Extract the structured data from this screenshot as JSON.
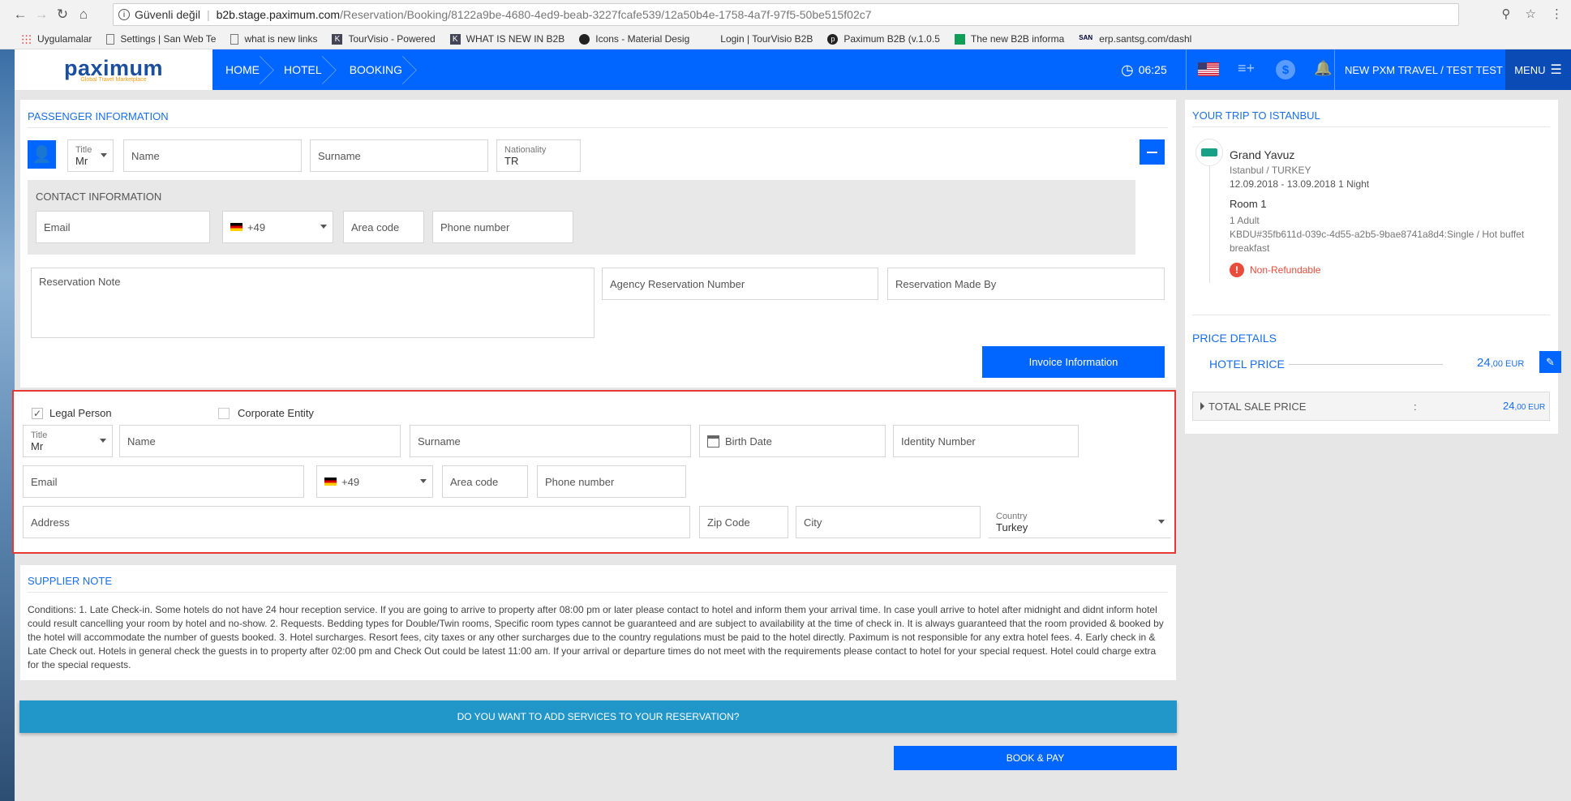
{
  "browser": {
    "security": "Güvenli değil",
    "url_host": "b2b.stage.paximum.com",
    "url_path": "/Reservation/Booking/8122a9be-4680-4ed9-beab-3227fcafe539/12a50b4e-1758-4a7f-97f5-50be515f02c7",
    "bookmarks": [
      {
        "label": "Uygulamalar",
        "icon": "apps-grid-icon"
      },
      {
        "label": "Settings | San Web Te",
        "icon": "page-icon"
      },
      {
        "label": "what is new links",
        "icon": "page-icon"
      },
      {
        "label": "TourVisio - Powered",
        "icon": "k-icon"
      },
      {
        "label": "WHAT IS NEW IN B2B",
        "icon": "k-icon"
      },
      {
        "label": "Icons - Material Desig",
        "icon": "github-icon"
      },
      {
        "label": "Login | TourVisio B2B",
        "icon": "blank-icon"
      },
      {
        "label": "Paximum B2B (v.1.0.5",
        "icon": "p-icon"
      },
      {
        "label": "The new B2B informa",
        "icon": "sheets-icon"
      },
      {
        "label": "erp.santsg.com/dashl",
        "icon": "san-icon"
      }
    ]
  },
  "header": {
    "logo": "paximum",
    "logo_sub": "Global Travel Marketplace",
    "breadcrumbs": [
      "HOME",
      "HOTEL",
      "BOOKING"
    ],
    "timer": "06:25",
    "agency": "NEW PXM TRAVEL / TEST TEST",
    "menu": "MENU"
  },
  "passenger": {
    "title": "PASSENGER INFORMATION",
    "title_label": "Title",
    "title_value": "Mr",
    "name_placeholder": "Name",
    "surname_placeholder": "Surname",
    "nationality_label": "Nationality",
    "nationality_value": "TR",
    "contact_title": "CONTACT INFORMATION",
    "email_placeholder": "Email",
    "phone_code": "+49",
    "area_placeholder": "Area code",
    "phone_placeholder": "Phone number",
    "note_placeholder": "Reservation Note",
    "agency_res_placeholder": "Agency Reservation Number",
    "made_by_placeholder": "Reservation Made By",
    "invoice_button": "Invoice Information"
  },
  "invoice": {
    "legal_person": "Legal Person",
    "corporate_entity": "Corporate Entity",
    "title_label": "Title",
    "title_value": "Mr",
    "name_placeholder": "Name",
    "surname_placeholder": "Surname",
    "birth_placeholder": "Birth Date",
    "identity_placeholder": "Identity Number",
    "email_placeholder": "Email",
    "phone_code": "+49",
    "area_placeholder": "Area code",
    "phone_placeholder": "Phone number",
    "address_placeholder": "Address",
    "zip_placeholder": "Zip Code",
    "city_placeholder": "City",
    "country_label": "Country",
    "country_value": "Turkey"
  },
  "supplier": {
    "title": "SUPPLIER NOTE",
    "text": "Conditions: 1. Late Check-in. Some hotels do not have 24 hour reception service. If you are going to arrive to property after 08:00 pm or later please contact to hotel and inform them your arrival time. In case youll arrive to hotel after midnight and didnt inform hotel could result cancelling your room by hotel and no-show. 2. Requests. Bedding types for Double/Twin rooms, Specific room types cannot be guaranteed and are subject to availability at the time of check in. It is always guaranteed that the room provided & booked by the hotel will accommodate the number of guests booked. 3. Hotel surcharges. Resort fees, city taxes or any other surcharges due to the country regulations must be paid to the hotel directly. Paximum is not responsible for any extra hotel fees. 4. Early check in & Late Check out. Hotels in general check the guests in to property after 02:00 pm and Check Out could be latest 11:00 am. If your arrival or departure times do not meet with the requirements please contact to hotel for your special request. Hotel could charge extra for the special requests."
  },
  "services_button": "DO YOU WANT TO ADD SERVICES TO YOUR RESERVATION?",
  "book_button": "BOOK & PAY",
  "trip": {
    "title": "YOUR TRIP TO ISTANBUL",
    "hotel": "Grand Yavuz",
    "location": "Istanbul / TURKEY",
    "dates": "12.09.2018 - 13.09.2018 1 Night",
    "room": "Room 1",
    "pax": "1 Adult",
    "room_desc": "KBDU#35fb611d-039c-4d55-a2b5-9bae8741a8d4:Single / Hot buffet breakfast",
    "refund": "Non-Refundable",
    "refund_color": "#e74c3c"
  },
  "price": {
    "title": "PRICE DETAILS",
    "hotel_label": "HOTEL PRICE",
    "hotel_int": "24",
    "hotel_dec": ",00 EUR",
    "total_label": "TOTAL SALE PRICE",
    "total_colon": ":",
    "total_int": "24",
    "total_dec": ",00 EUR"
  },
  "colors": {
    "primary": "#0066ff",
    "teal": "#2196c9",
    "highlight": "#e53935"
  }
}
